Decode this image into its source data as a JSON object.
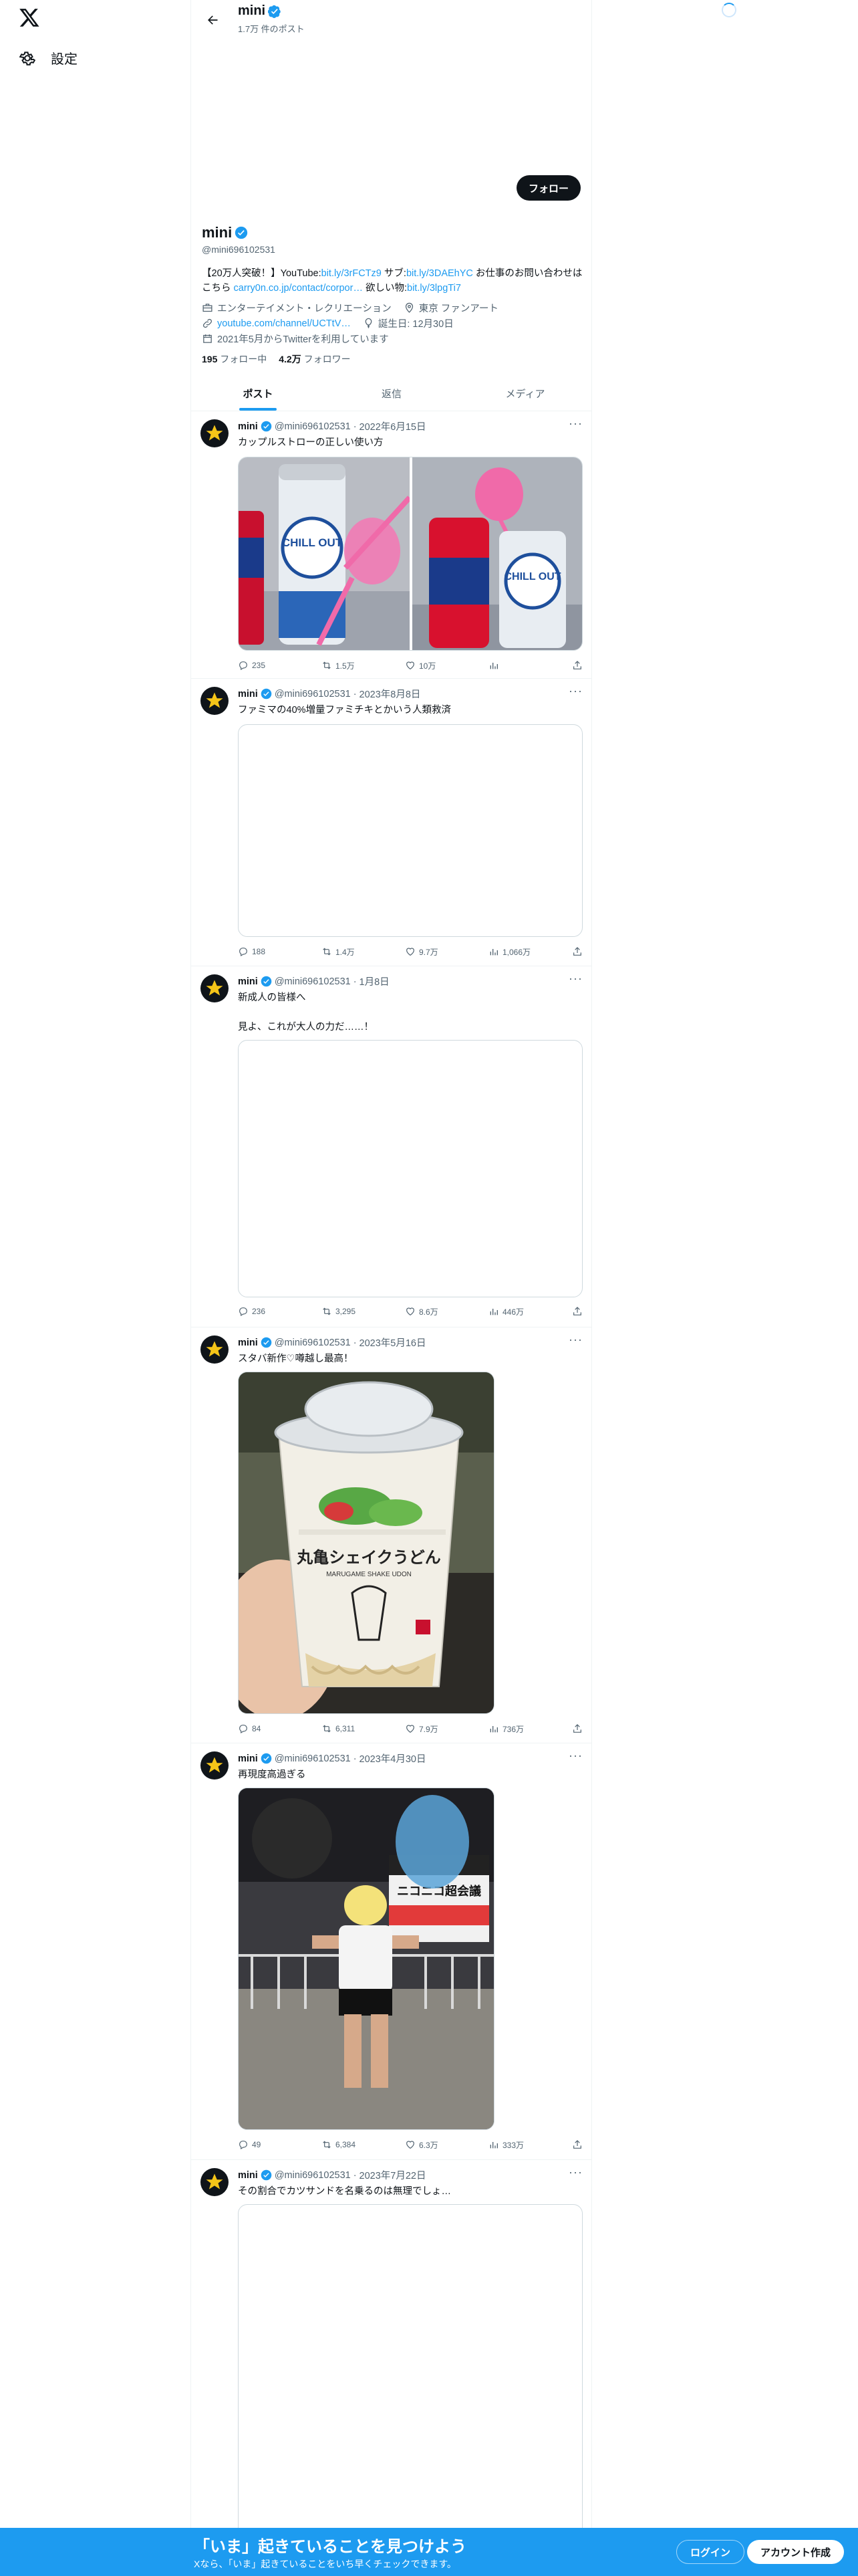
{
  "colors": {
    "accent": "#1d9bf0",
    "text": "#0f1419",
    "muted": "#536471",
    "banner": "#1d9bf0"
  },
  "nav": {
    "logo_icon": "x-logo-icon",
    "settings_label": "設定",
    "settings_icon": "gear-icon"
  },
  "header": {
    "name": "mini",
    "post_count": "1.7万 件のポスト"
  },
  "profile": {
    "follow_label": "フォロー",
    "name": "mini",
    "handle": "@mini696102531",
    "bio": {
      "p1": "【20万人突破！】YouTube:",
      "l1": "bit.ly/3rFCTz9",
      "p2": " サブ:",
      "l2": "bit.ly/3DAEhYC",
      "p3": " お仕事のお問い合わせはこちら ",
      "l3": "carry0n.co.jp/contact/corpor…",
      "p4": " 欲しい物:",
      "l4": "bit.ly/3lpgTi7"
    },
    "category": "エンターテイメント・レクリエーション",
    "location": "東京 ファンアート",
    "website": "youtube.com/channel/UCTtV…",
    "birthday": "誕生日: 12月30日",
    "joined": "2021年5月からTwitterを利用しています",
    "following_count": "195",
    "following_label": "フォロー中",
    "followers_count": "4.2万",
    "followers_label": "フォロワー"
  },
  "tabs": [
    "ポスト",
    "返信",
    "メディア"
  ],
  "tweets": [
    {
      "name": "mini",
      "handle": "@mini696102531",
      "date": "2022年6月15日",
      "text": "カップルストローの正しい使い方",
      "replies": "235",
      "retweets": "1.5万",
      "likes": "10万",
      "views": ""
    },
    {
      "name": "mini",
      "handle": "@mini696102531",
      "date": "2023年8月8日",
      "text": "ファミマの40%増量ファミチキとかいう人類救済",
      "replies": "188",
      "retweets": "1.4万",
      "likes": "9.7万",
      "views": "1,066万"
    },
    {
      "name": "mini",
      "handle": "@mini696102531",
      "date": "1月8日",
      "text": "新成人の皆様へ\n\n見よ、これが大人の力だ……！",
      "replies": "236",
      "retweets": "3,295",
      "likes": "8.6万",
      "views": "446万"
    },
    {
      "name": "mini",
      "handle": "@mini696102531",
      "date": "2023年5月16日",
      "text": "スタバ新作♡噂越し最高！",
      "replies": "84",
      "retweets": "6,311",
      "likes": "7.9万",
      "views": "736万"
    },
    {
      "name": "mini",
      "handle": "@mini696102531",
      "date": "2023年4月30日",
      "text": "再現度高過ぎる",
      "replies": "49",
      "retweets": "6,384",
      "likes": "6.3万",
      "views": "333万"
    },
    {
      "name": "mini",
      "handle": "@mini696102531",
      "date": "2023年7月22日",
      "text": "その割合でカツサンドを名乗るのは無理でしょ…",
      "replies": "",
      "retweets": "",
      "likes": "",
      "views": ""
    }
  ],
  "media": {
    "can_label_chill": "CHILL OUT",
    "cup_label": "丸亀シェイクうどん",
    "cup_sub": "MARUGAME SHAKE UDON",
    "banner_sign": "ニコニコ超会議"
  },
  "banner": {
    "title": "「いま」起きていることを見つけよう",
    "subtitle": "Xなら、「いま」起きていることをいち早くチェックできます。",
    "login_label": "ログイン",
    "signup_label": "アカウント作成"
  }
}
